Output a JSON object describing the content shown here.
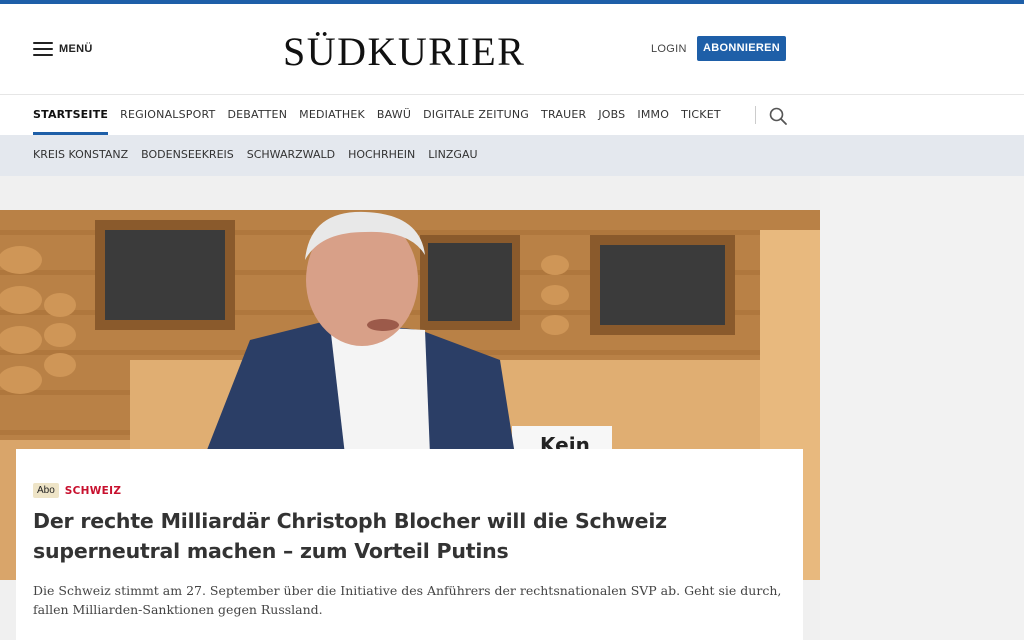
{
  "header": {
    "menu_label": "MENÜ",
    "logo_text": "SÜDKURIER",
    "login_label": "LOGIN",
    "subscribe_label": "ABONNIEREN"
  },
  "nav": {
    "items": [
      "STARTSEITE",
      "REGIONALSPORT",
      "DEBATTEN",
      "MEDIATHEK",
      "BAWÜ",
      "DIGITALE ZEITUNG",
      "TRAUER",
      "JOBS",
      "IMMO",
      "TICKET"
    ],
    "active": "STARTSEITE",
    "search_icon": "search-icon"
  },
  "subnav": {
    "items": [
      "KREIS KONSTANZ",
      "BODENSEEKREIS",
      "SCHWARZWALD",
      "HOCHRHEIN",
      "LINZGAU"
    ]
  },
  "hero": {
    "sign_text": "Kein"
  },
  "article": {
    "badge": "Abo",
    "kicker": "SCHWEIZ",
    "headline": "Der rechte Milliardär Christoph Blocher will die Schweiz superneutral machen – zum Vorteil Putins",
    "teaser": "Die Schweiz stimmt am 27. September über die Initiative des Anführers der rechtsnationalen SVP ab. Geht sie durch, fallen Milliarden-Sanktionen gegen Russland."
  },
  "colors": {
    "brand_blue": "#1e5fa8",
    "kicker_red": "#c8102e",
    "subnav_bg": "#e4e8ee"
  }
}
